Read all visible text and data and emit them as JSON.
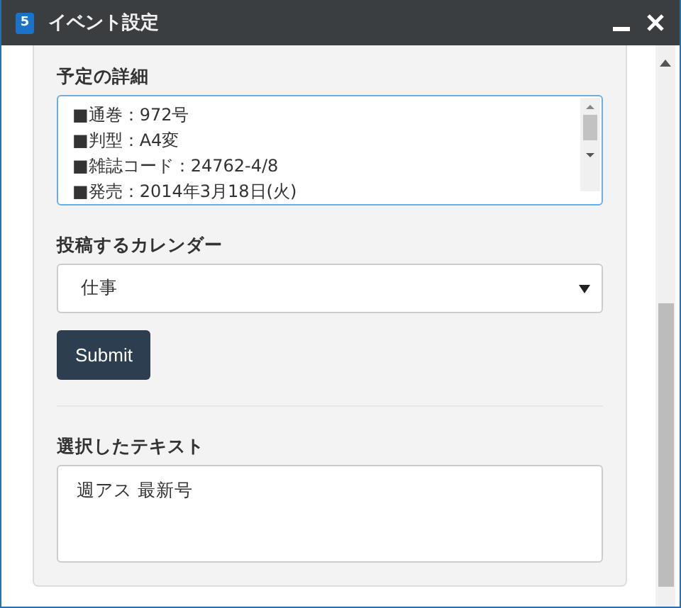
{
  "window": {
    "title": "イベント設定",
    "app_icon": "5"
  },
  "details": {
    "label": "予定の詳細",
    "lines": [
      "■通巻：972号",
      "■判型：A4変",
      "■雑誌コード：24762-4/8",
      "■発売：2014年3月18日(火)"
    ]
  },
  "calendar": {
    "label": "投稿するカレンダー",
    "value": "仕事"
  },
  "submit": "Submit",
  "selected_text": {
    "label": "選択したテキスト",
    "value": "週アス 最新号"
  }
}
